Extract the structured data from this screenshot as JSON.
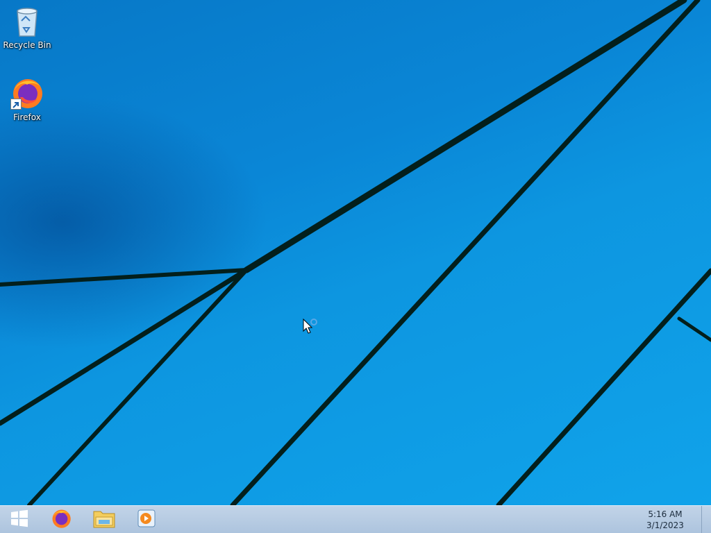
{
  "desktop": {
    "icons": [
      {
        "label": "Recycle Bin",
        "icon": "recycle-bin-icon"
      },
      {
        "label": "Firefox",
        "icon": "firefox-icon"
      }
    ]
  },
  "taskbar": {
    "start_icon": "windows-logo-icon",
    "pinned": [
      {
        "name": "Firefox",
        "icon": "firefox-icon"
      },
      {
        "name": "File Explorer",
        "icon": "folder-icon"
      },
      {
        "name": "Media Player",
        "icon": "media-player-icon"
      }
    ],
    "clock": {
      "time": "5:16 AM",
      "date": "3/1/2023"
    }
  },
  "colors": {
    "wallpaper_blue": "#0a8ad9",
    "taskbar": "#b4c9e0",
    "line": "#031f1c"
  }
}
